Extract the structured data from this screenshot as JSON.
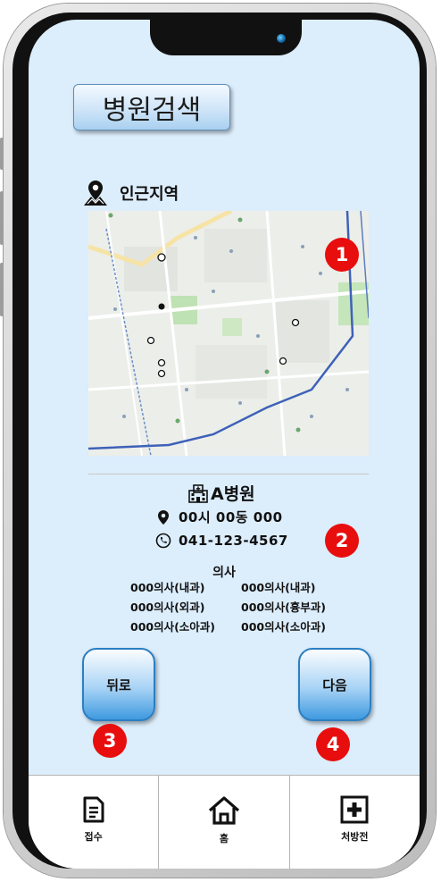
{
  "header": {
    "title": "병원검색"
  },
  "map_section": {
    "label": "인근지역",
    "marker_badge": "1"
  },
  "hospital": {
    "name": "A병원",
    "address": "00시 00동 000",
    "phone": "041-123-4567",
    "info_badge": "2",
    "doctor_heading": "의사",
    "doctors": [
      "000의사(내과)",
      "000의사(내과)",
      "000의사(외과)",
      "000의사(흉부과)",
      "000의사(소아과)",
      "000의사(소아과)"
    ]
  },
  "buttons": {
    "back_label": "뒤로",
    "back_badge": "3",
    "next_label": "다음",
    "next_badge": "4"
  },
  "tabbar": {
    "items": [
      {
        "label": "접수",
        "icon": "document-icon"
      },
      {
        "label": "홈",
        "icon": "home-icon"
      },
      {
        "label": "처방전",
        "icon": "medical-cross-icon"
      }
    ]
  },
  "colors": {
    "screen_bg": "#dcedfb",
    "badge_red": "#e80e0e",
    "button_blue": "#3f9ae0"
  }
}
